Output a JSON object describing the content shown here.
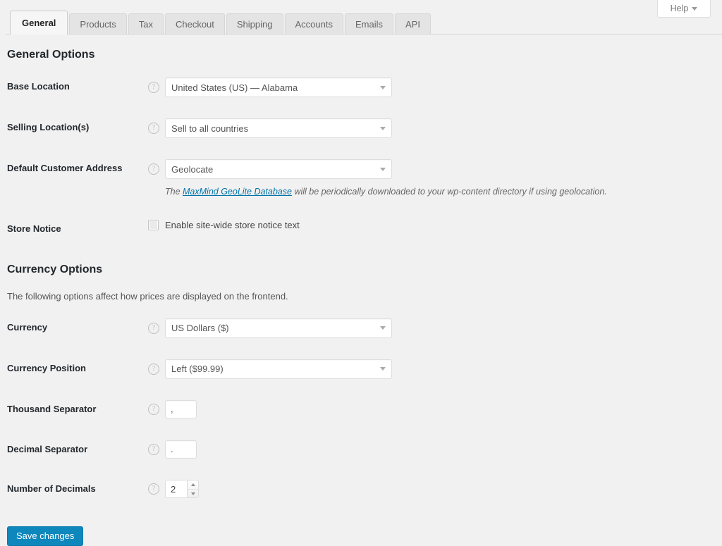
{
  "help_button": {
    "label": "Help",
    "icon": "chevron-down-icon"
  },
  "tabs": [
    {
      "label": "General",
      "active": true
    },
    {
      "label": "Products",
      "active": false
    },
    {
      "label": "Tax",
      "active": false
    },
    {
      "label": "Checkout",
      "active": false
    },
    {
      "label": "Shipping",
      "active": false
    },
    {
      "label": "Accounts",
      "active": false
    },
    {
      "label": "Emails",
      "active": false
    },
    {
      "label": "API",
      "active": false
    }
  ],
  "general_options": {
    "title": "General Options",
    "base_location": {
      "label": "Base Location",
      "value": "United States (US) — Alabama",
      "help_icon": "help-circle-icon"
    },
    "selling_locations": {
      "label": "Selling Location(s)",
      "value": "Sell to all countries",
      "help_icon": "help-circle-icon"
    },
    "default_customer_address": {
      "label": "Default Customer Address",
      "value": "Geolocate",
      "help_icon": "help-circle-icon",
      "description_prefix": "The ",
      "description_link": "MaxMind GeoLite Database",
      "description_suffix": " will be periodically downloaded to your wp-content directory if using geolocation."
    },
    "store_notice": {
      "label": "Store Notice",
      "checkbox_label": "Enable site-wide store notice text",
      "checked": false
    }
  },
  "currency_options": {
    "title": "Currency Options",
    "description": "The following options affect how prices are displayed on the frontend.",
    "currency": {
      "label": "Currency",
      "value": "US Dollars ($)",
      "help_icon": "help-circle-icon"
    },
    "currency_position": {
      "label": "Currency Position",
      "value": "Left ($99.99)",
      "help_icon": "help-circle-icon"
    },
    "thousand_separator": {
      "label": "Thousand Separator",
      "value": ",",
      "help_icon": "help-circle-icon"
    },
    "decimal_separator": {
      "label": "Decimal Separator",
      "value": ".",
      "help_icon": "help-circle-icon"
    },
    "number_of_decimals": {
      "label": "Number of Decimals",
      "value": "2",
      "help_icon": "help-circle-icon"
    }
  },
  "submit": {
    "label": "Save changes"
  },
  "colors": {
    "page_background": "#f1f1f1",
    "primary_button": "#0e87bd",
    "link": "#0073aa",
    "heading": "#23282d",
    "active_tab_background": "#f6f6f6",
    "inactive_tab_background": "#e4e4e4"
  },
  "help_tip_glyph": "?"
}
